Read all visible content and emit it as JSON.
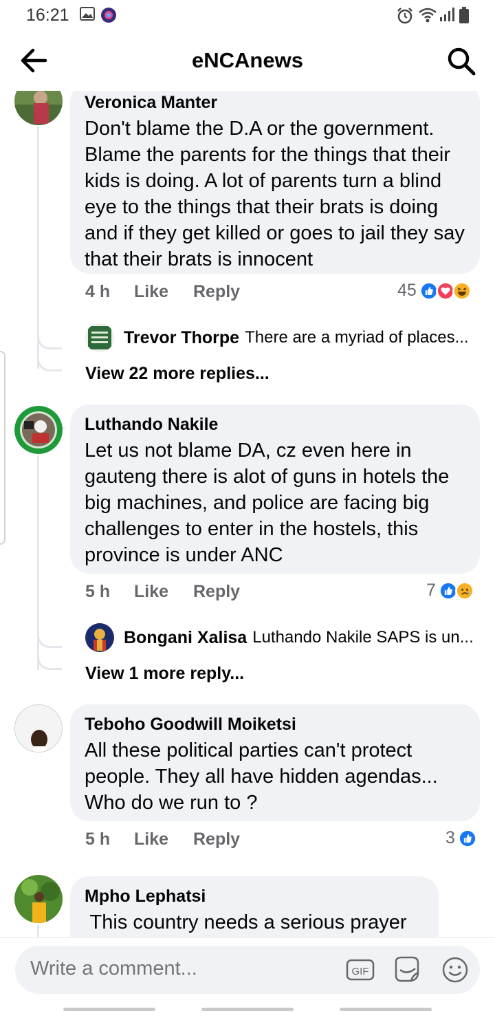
{
  "status_bar": {
    "time": "16:21"
  },
  "header": {
    "title": "eNCAnews"
  },
  "comments": [
    {
      "author": "Veronica Manter",
      "text": "Don't blame the D.A or the government. Blame the parents for the things that their kids is doing. A lot of parents turn a blind eye to the things that their brats is doing and if they get killed or goes to jail they say that their brats is innocent",
      "time": "4 h",
      "like_label": "Like",
      "reply_label": "Reply",
      "reaction_count": "45",
      "reactions": [
        "like",
        "love",
        "haha"
      ],
      "reply_preview": {
        "author": "Trevor Thorpe",
        "text": "There are a myriad of places..."
      },
      "view_more": "View 22 more replies..."
    },
    {
      "author": "Luthando Nakile",
      "text": "Let us not blame DA, cz even here in gauteng there is alot of guns in hotels the big machines, and police are facing big challenges to enter in the hostels, this province is under ANC",
      "time": "5 h",
      "like_label": "Like",
      "reply_label": "Reply",
      "reaction_count": "7",
      "reactions": [
        "like",
        "sad"
      ],
      "reply_preview": {
        "author": "Bongani Xalisa",
        "text": "Luthando Nakile SAPS is un..."
      },
      "view_more": "View 1 more reply..."
    },
    {
      "author": "Teboho Goodwill Moiketsi",
      "text": "All these political parties can't protect people. They all have hidden agendas... Who do we run to ?",
      "time": "5 h",
      "like_label": "Like",
      "reply_label": "Reply",
      "reaction_count": "3",
      "reactions": [
        "like"
      ]
    },
    {
      "author": "Mpho Lephatsi",
      "text": " This country needs a serious prayer"
    }
  ],
  "composer": {
    "placeholder": "Write a comment..."
  },
  "colors": {
    "like_blue": "#1877f2",
    "love_red": "#f33e58",
    "haha_yellow": "#f7b125",
    "bubble_gray": "#f0f2f5",
    "meta_gray": "#65676b"
  }
}
